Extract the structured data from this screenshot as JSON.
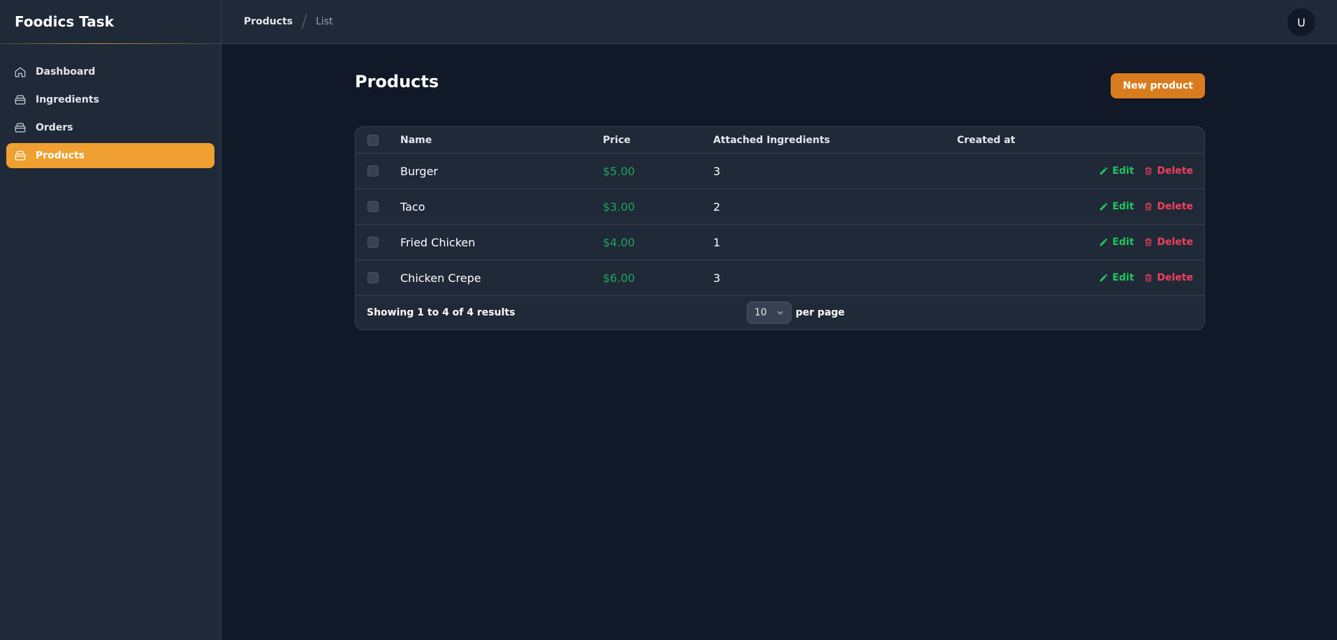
{
  "app": {
    "title": "Foodics Task"
  },
  "sidebar": {
    "items": [
      {
        "label": "Dashboard",
        "icon": "home-icon",
        "active": false
      },
      {
        "label": "Ingredients",
        "icon": "box-icon",
        "active": false
      },
      {
        "label": "Orders",
        "icon": "box-icon",
        "active": false
      },
      {
        "label": "Products",
        "icon": "box-icon",
        "active": true
      }
    ]
  },
  "breadcrumb": {
    "root": "Products",
    "current": "List"
  },
  "user": {
    "avatar_letter": "U"
  },
  "page": {
    "title": "Products",
    "new_button": "New product"
  },
  "table": {
    "headers": {
      "name": "Name",
      "price": "Price",
      "ingredients": "Attached Ingredients",
      "created": "Created at"
    },
    "rows": [
      {
        "name": "Burger",
        "price": "$5.00",
        "ingredients": "3",
        "created": ""
      },
      {
        "name": "Taco",
        "price": "$3.00",
        "ingredients": "2",
        "created": ""
      },
      {
        "name": "Fried Chicken",
        "price": "$4.00",
        "ingredients": "1",
        "created": ""
      },
      {
        "name": "Chicken Crepe",
        "price": "$6.00",
        "ingredients": "3",
        "created": ""
      }
    ],
    "actions": {
      "edit": "Edit",
      "delete": "Delete"
    },
    "footer": {
      "showing": "Showing 1 to 4 of 4 results",
      "per_page_value": "10",
      "per_page_label": "per page"
    }
  },
  "colors": {
    "accent": "#f0a030",
    "primary_button": "#d97c1f",
    "price": "#22a55a",
    "edit": "#22c55e",
    "delete": "#f43f5e"
  }
}
